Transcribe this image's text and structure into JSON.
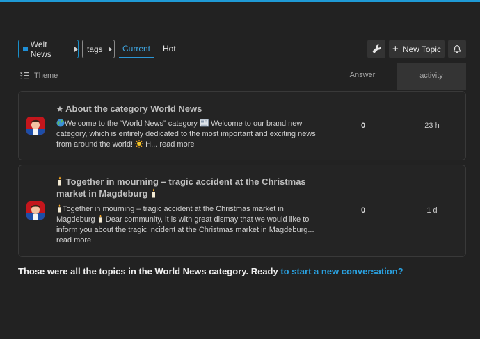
{
  "nav": {
    "category_label": "Welt News",
    "tags_label": "tags",
    "tabs": [
      {
        "label": "Current",
        "active": true
      },
      {
        "label": "Hot",
        "active": false
      }
    ],
    "new_topic_label": "New Topic"
  },
  "list_header": {
    "theme": "Theme",
    "answer": "Answer",
    "activity": "activity"
  },
  "topics": [
    {
      "title": "About the category World News",
      "excerpt_a": "Welcome to the “World News” category",
      "excerpt_b": " Welcome to our brand new category, which is entirely dedicated to the most important and exciting news from around the world! ",
      "excerpt_c": " H... ",
      "read_more": "read more",
      "answers": "0",
      "activity": "23 h"
    },
    {
      "title": "Together in mourning – tragic accident at the Christmas market in Magdeburg",
      "excerpt_a": "Together in mourning – tragic accident at the Christmas market in Magdeburg",
      "excerpt_b": " Dear community, it is with great dismay that we would like to inform you about the tragic incident at the Christmas market in Magdeburg... ",
      "read_more": "read more",
      "answers": "0",
      "activity": "1 d"
    }
  ],
  "footer": {
    "text": "Those were all the topics in the World News category. Ready ",
    "link": "to start a new conversation?"
  },
  "colors": {
    "accent": "#2aa1e0",
    "background": "#222222",
    "top_bar": "#1f9ad6"
  }
}
